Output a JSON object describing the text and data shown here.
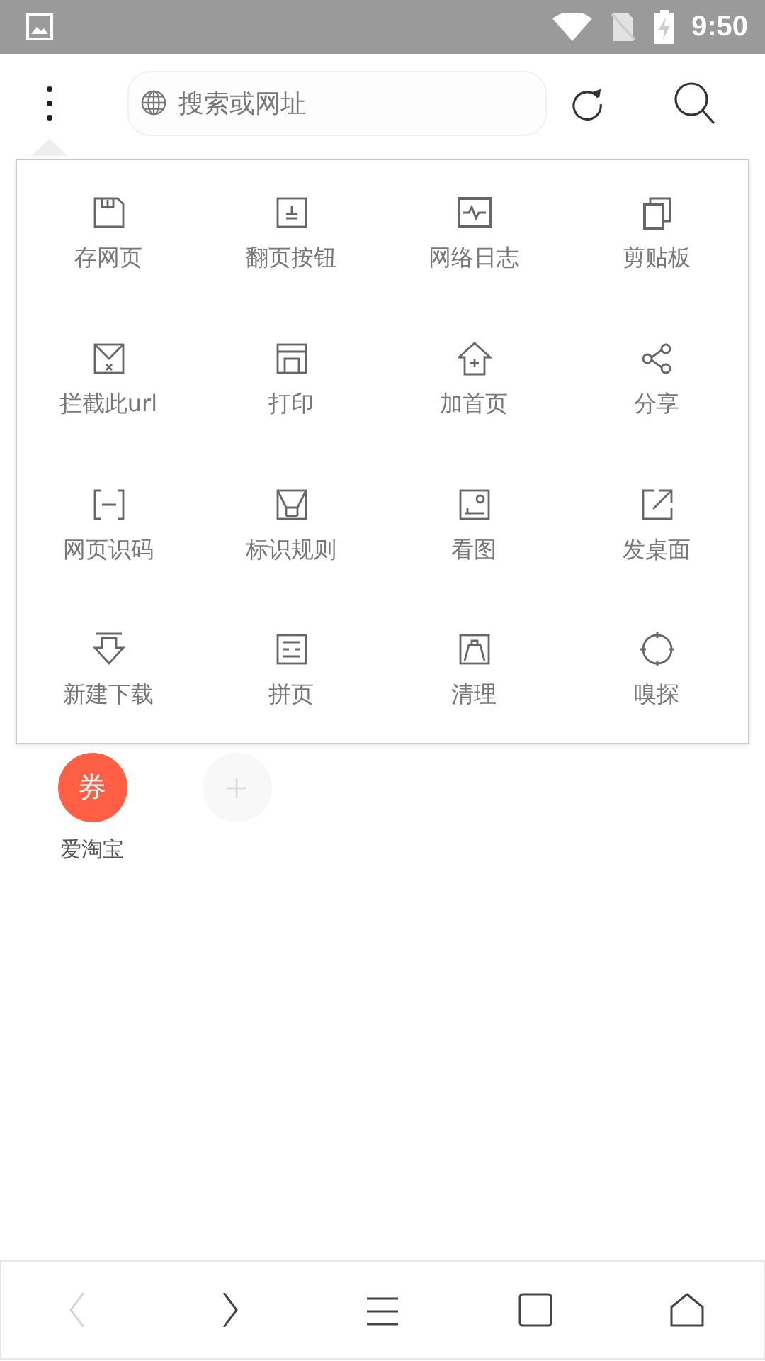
{
  "status_bar": {
    "time": "9:50"
  },
  "toolbar": {
    "search": {
      "placeholder": "搜索或网址"
    }
  },
  "menu": {
    "items": [
      {
        "label": "存网页"
      },
      {
        "label": "翻页按钮"
      },
      {
        "label": "网络日志"
      },
      {
        "label": "剪贴板"
      },
      {
        "label": "拦截此url"
      },
      {
        "label": "打印"
      },
      {
        "label": "加首页"
      },
      {
        "label": "分享"
      },
      {
        "label": "网页识码"
      },
      {
        "label": "标识规则"
      },
      {
        "label": "看图"
      },
      {
        "label": "发桌面"
      },
      {
        "label": "新建下载"
      },
      {
        "label": "拼页"
      },
      {
        "label": "清理"
      },
      {
        "label": "嗅探"
      }
    ]
  },
  "shortcuts": [
    {
      "kind": "site",
      "glyph": "券",
      "label": "爱淘宝",
      "color": "#ff5f45"
    },
    {
      "kind": "add"
    }
  ],
  "bottom_nav": [
    {
      "kind": "back",
      "disabled": true
    },
    {
      "kind": "forward",
      "disabled": false
    },
    {
      "kind": "menu",
      "disabled": false
    },
    {
      "kind": "tabs",
      "disabled": false
    },
    {
      "kind": "home",
      "disabled": false
    }
  ]
}
